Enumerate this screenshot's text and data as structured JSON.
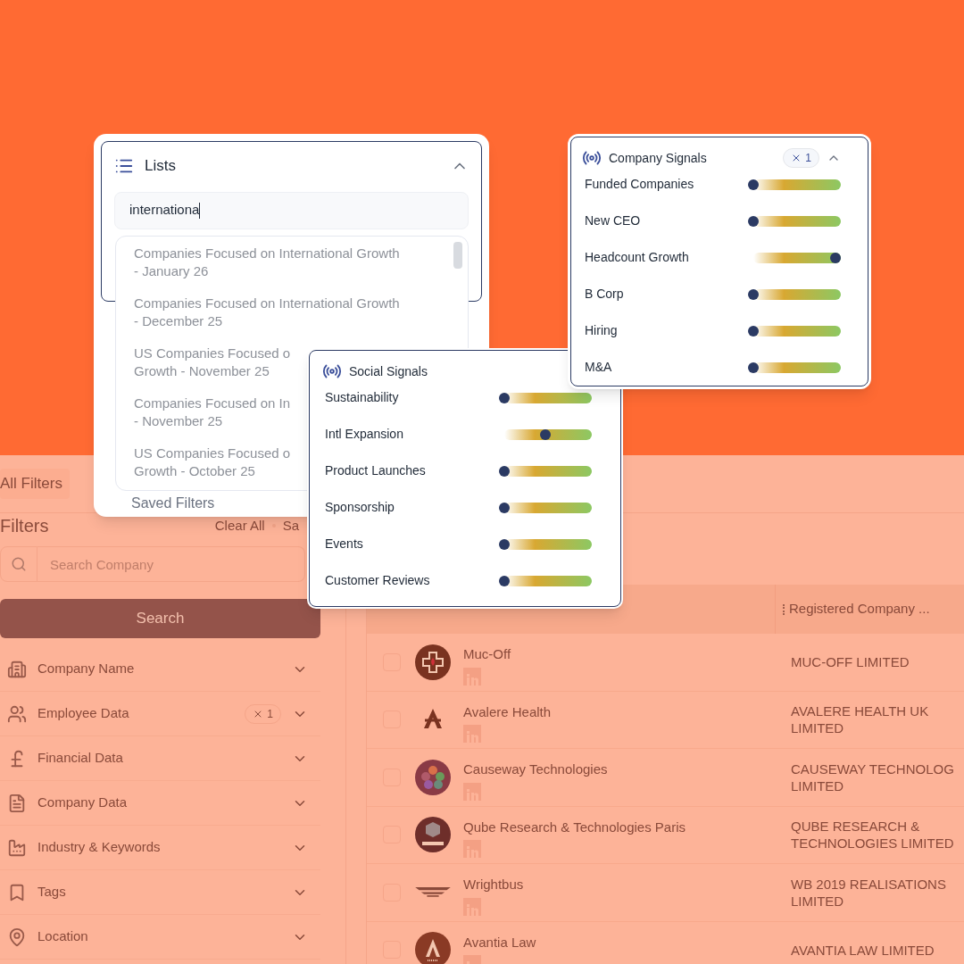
{
  "lists_panel": {
    "title": "Lists",
    "expanded": true,
    "search_value": "internationa",
    "results": [
      {
        "lines": [
          "Companies Focused on International Growth",
          "- January 26"
        ]
      },
      {
        "lines": [
          "Companies Focused on International Growth",
          "- December 25"
        ]
      },
      {
        "lines": [
          "US Companies Focused o",
          "Growth - November 25"
        ]
      },
      {
        "lines": [
          "Companies Focused on In",
          "- November 25"
        ]
      },
      {
        "lines": [
          "US Companies Focused o",
          "Growth - October 25"
        ]
      }
    ],
    "saved_filters": "Saved Filters"
  },
  "company_signals": {
    "title": "Company Signals",
    "badge": "1",
    "expanded": true,
    "signals": [
      {
        "name": "Funded Companies",
        "level": 0
      },
      {
        "name": "New CEO",
        "level": 0
      },
      {
        "name": "Headcount Growth",
        "level": 1
      },
      {
        "name": "B Corp",
        "level": 0
      },
      {
        "name": "Hiring",
        "level": 0
      },
      {
        "name": "M&A",
        "level": 0
      }
    ]
  },
  "social_signals": {
    "title": "Social Signals",
    "signals": [
      {
        "name": "Sustainability",
        "level": 0
      },
      {
        "name": "Intl Expansion",
        "level": 0.5
      },
      {
        "name": "Product Launches",
        "level": 0
      },
      {
        "name": "Sponsorship",
        "level": 0
      },
      {
        "name": "Events",
        "level": 0
      },
      {
        "name": "Customer Reviews",
        "level": 0
      }
    ]
  },
  "top_tab": {
    "label": "All Filters",
    "selected": true
  },
  "sidebar": {
    "title": "Filters",
    "clear_all": "Clear All",
    "save": "Sa",
    "search_placeholder": "Search Company",
    "search_button": "Search",
    "sections": [
      {
        "label": "Company Name",
        "expanded": false
      },
      {
        "label": "Employee Data",
        "expanded": false,
        "badge": "1"
      },
      {
        "label": "Financial Data",
        "expanded": false
      },
      {
        "label": "Company Data",
        "expanded": false
      },
      {
        "label": "Industry & Keywords",
        "expanded": false
      },
      {
        "label": "Tags",
        "expanded": false
      },
      {
        "label": "Location",
        "expanded": false
      }
    ]
  },
  "table": {
    "column_2": "Registered Company ...",
    "rows": [
      {
        "company": "Muc-Off",
        "registered_name": "MUC-OFF LIMITED",
        "checked": false
      },
      {
        "company": "Avalere Health",
        "registered_name": "AVALERE HEALTH UK LIMITED",
        "checked": false
      },
      {
        "company": "Causeway Technologies",
        "registered_name": "CAUSEWAY TECHNOLOG LIMITED",
        "checked": false
      },
      {
        "company": "Qube Research & Technologies Paris",
        "registered_name": "QUBE RESEARCH & TECHNOLOGIES LIMITED",
        "checked": false
      },
      {
        "company": "Wrightbus",
        "registered_name": "WB 2019 REALISATIONS LIMITED",
        "checked": false
      },
      {
        "company": "Avantia Law",
        "registered_name": "AVANTIA LAW LIMITED",
        "checked": false
      }
    ]
  }
}
